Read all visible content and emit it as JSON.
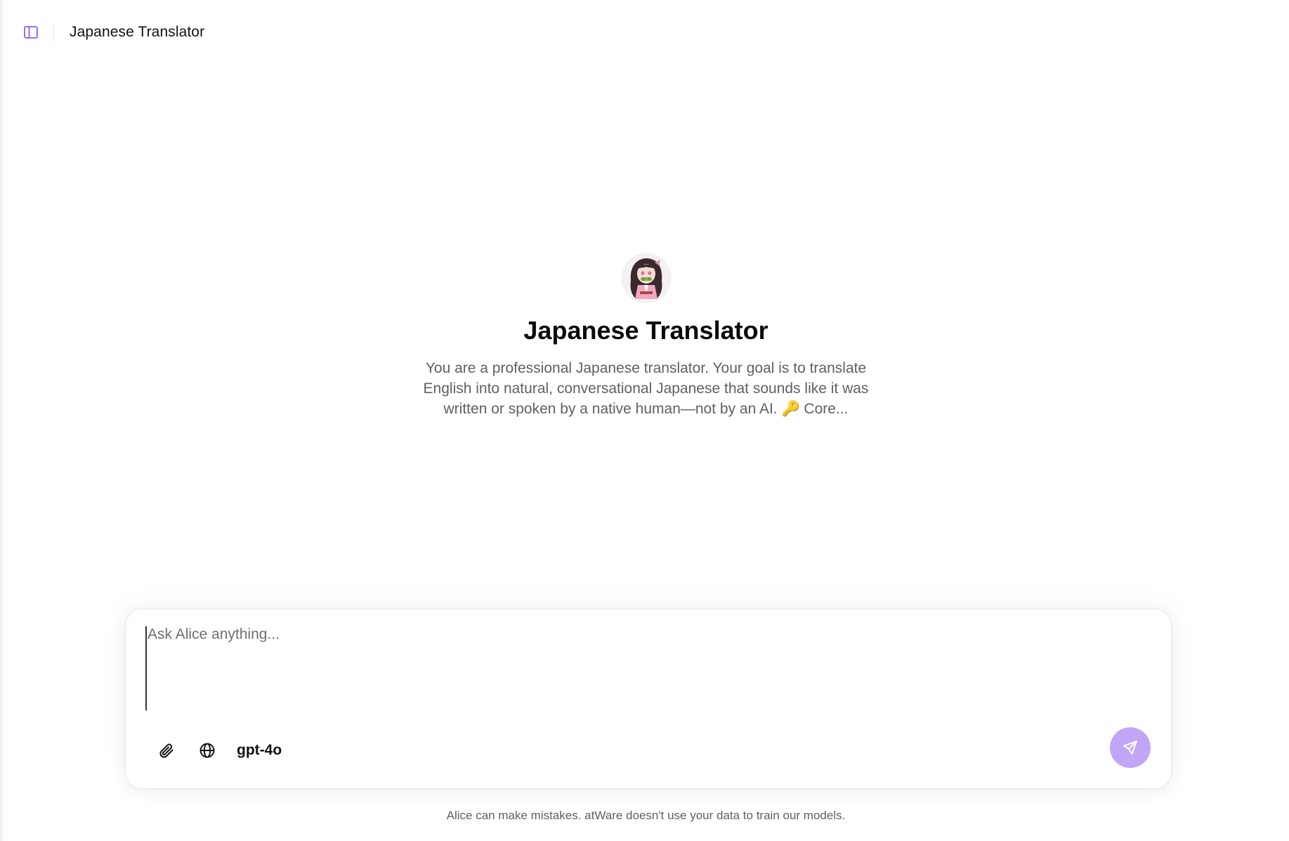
{
  "header": {
    "title": "Japanese Translator",
    "sidebar_toggle_icon": "sidebar-panel-icon"
  },
  "assistant": {
    "name": "Japanese Translator",
    "description": "You are a professional Japanese translator. Your goal is to translate English into natural, conversational Japanese that sounds like it was written or spoken by a native human—not by an AI. 🔑 Core..."
  },
  "composer": {
    "placeholder": "Ask Alice anything...",
    "value": "",
    "attach_icon": "paperclip-icon",
    "web_icon": "globe-icon",
    "model": "gpt-4o",
    "send_icon": "send-icon"
  },
  "footer": {
    "note": "Alice can make mistakes. atWare doesn't use your data to train our models."
  },
  "colors": {
    "accent": "#8b5cf6",
    "send_button": "#c0a6f5",
    "muted_text": "#5f6068"
  }
}
